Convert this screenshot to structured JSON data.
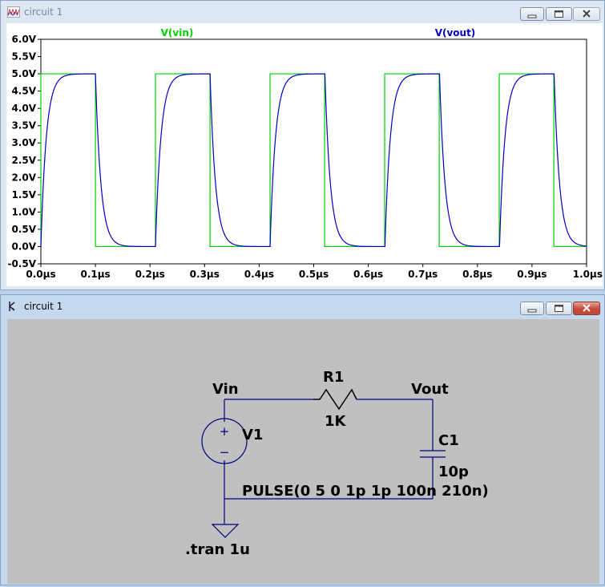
{
  "plot_window": {
    "title": "circuit 1",
    "icon": "waveform-icon",
    "buttons": [
      "minimize-icon",
      "maximize-icon",
      "close-icon"
    ]
  },
  "schematic_window": {
    "title": "circuit 1",
    "icon": "schematic-icon",
    "buttons": [
      "minimize-icon",
      "maximize-icon",
      "close-icon"
    ]
  },
  "colors": {
    "vin": "#00d000",
    "vout": "#0000c0",
    "wire": "#000080",
    "plot_bg": "#ffffff",
    "schematic_bg": "#c0c0c0",
    "close_button": "#c9483a"
  },
  "chart_data": {
    "type": "line",
    "title": "",
    "xlabel": "",
    "ylabel": "",
    "xlim": [
      0,
      1.0
    ],
    "ylim": [
      -0.5,
      6.0
    ],
    "x_unit": "µs",
    "y_unit": "V",
    "x_ticks": [
      "0.0µs",
      "0.1µs",
      "0.2µs",
      "0.3µs",
      "0.4µs",
      "0.5µs",
      "0.6µs",
      "0.7µs",
      "0.8µs",
      "0.9µs",
      "1.0µs"
    ],
    "y_ticks": [
      "6.0V",
      "5.5V",
      "5.0V",
      "4.5V",
      "4.0V",
      "3.5V",
      "3.0V",
      "2.5V",
      "2.0V",
      "1.5V",
      "1.0V",
      "0.5V",
      "0.0V",
      "-0.5V"
    ],
    "grid": false,
    "legend": "top",
    "series": [
      {
        "name": "V(vin)",
        "kind": "pulse",
        "low": 0,
        "high": 5,
        "delay": 0,
        "rise": 1e-06,
        "fall": 1e-06,
        "width": 0.1,
        "period": 0.21
      },
      {
        "name": "V(vout)",
        "kind": "rc_response",
        "tau": 0.01,
        "input": "V(vin)"
      }
    ]
  },
  "schematic": {
    "net_vin": "Vin",
    "net_vout": "Vout",
    "r_name": "R1",
    "r_value": "1K",
    "c_name": "C1",
    "c_value": "10p",
    "v_name": "V1",
    "v_value": "PULSE(0 5 0 1p 1p 100n 210n)",
    "directive": ".tran 1u",
    "plus_sign": "+",
    "minus_sign": "−"
  }
}
